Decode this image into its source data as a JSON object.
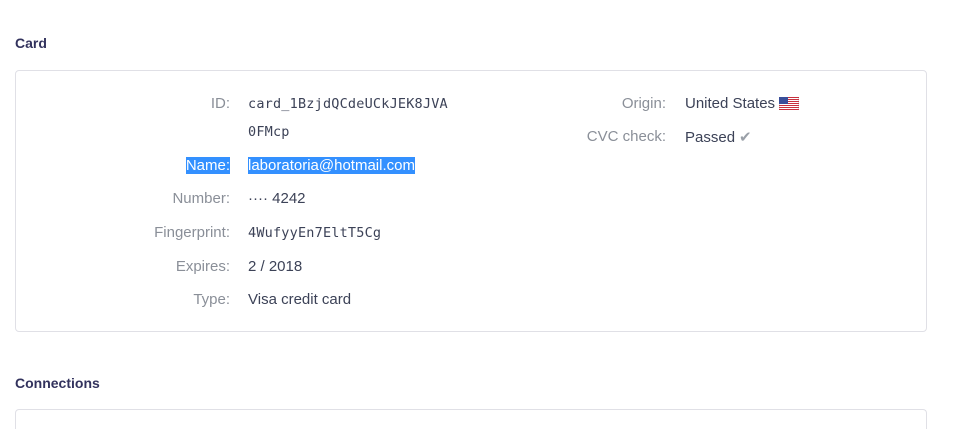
{
  "card_section": {
    "title": "Card",
    "fields": {
      "id": {
        "label": "ID:",
        "value_line1": "card_1BzjdQCdeUCkJEK8JVA",
        "value_line2": "0FMcp"
      },
      "name": {
        "label": "Name:",
        "value": "laboratoria@hotmail.com"
      },
      "number": {
        "label": "Number:",
        "value": "···· 4242"
      },
      "fingerprint": {
        "label": "Fingerprint:",
        "value": "4WufyyEn7EltT5Cg"
      },
      "expires": {
        "label": "Expires:",
        "value": "2 / 2018"
      },
      "type": {
        "label": "Type:",
        "value": "Visa credit card"
      },
      "origin": {
        "label": "Origin:",
        "value": "United States",
        "flag_icon": "us-flag-icon"
      },
      "cvc_check": {
        "label": "CVC check:",
        "value": "Passed",
        "status_icon": "checkmark-icon"
      }
    }
  },
  "connections_section": {
    "title": "Connections"
  },
  "colors": {
    "selection_highlight": "#3390ff",
    "label_gray": "#8a8f98",
    "title": "#32325d"
  }
}
